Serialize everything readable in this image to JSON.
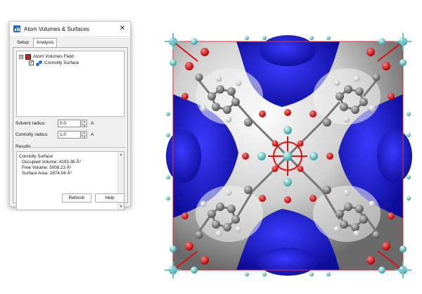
{
  "dialog": {
    "title": "Atom Volumes & Surfaces",
    "close_glyph": "✕",
    "tabs": [
      {
        "label": "Setup",
        "active": false
      },
      {
        "label": "Analysis",
        "active": true
      }
    ],
    "tree": {
      "expander_glyph": "⊟",
      "items": [
        {
          "label": "Atom Volumes Field",
          "icon": "field-icon"
        },
        {
          "label": "Connolly Surface",
          "icon": "surface-icon",
          "checked": true,
          "check_glyph": "✓"
        }
      ]
    },
    "solvent_radius": {
      "label": "Solvent radius:",
      "value": "0.0",
      "unit": "A"
    },
    "connolly_radius": {
      "label": "Connolly radius:",
      "value": "1.0",
      "unit": "A"
    },
    "spinner_up": "▲",
    "spinner_down": "▼",
    "results": {
      "label": "Results",
      "lines": [
        "Connolly Surface",
        "Occupied Volume: 4193.36 Å³",
        "Free Volume: 5008.23 Å³",
        "Surface Area: 2874.04 Å²"
      ]
    },
    "buttons": {
      "refresh": "Refresh",
      "help": "Help"
    }
  },
  "viewport": {
    "colors": {
      "free_volume": "#1b1bd6",
      "surface": "#d8d8d8",
      "cell_edge": "#e03030",
      "carbon": "#808080",
      "oxygen": "#dd1111",
      "hydrogen": "#f5f5f5",
      "metal": "#6fc6c8"
    }
  }
}
